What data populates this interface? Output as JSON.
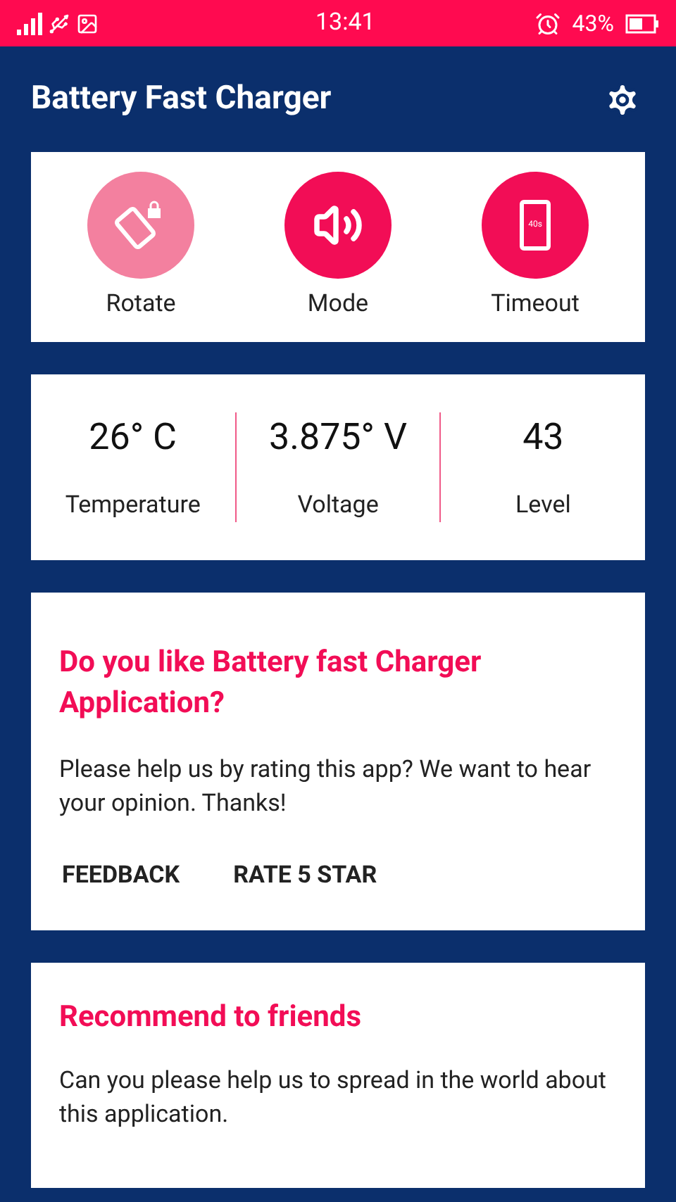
{
  "status_bar": {
    "time": "13:41",
    "battery": "43%"
  },
  "app_bar": {
    "title": "Battery Fast Charger"
  },
  "quick_actions": [
    {
      "kind": "rotate",
      "label": "Rotate",
      "on": false
    },
    {
      "kind": "mode",
      "label": "Mode",
      "on": true
    },
    {
      "kind": "timeout",
      "label": "Timeout",
      "on": true,
      "badge": "40s"
    }
  ],
  "stats": [
    {
      "value": "26° C",
      "label": "Temperature"
    },
    {
      "value": "3.875° V",
      "label": "Voltage"
    },
    {
      "value": "43",
      "label": "Level"
    }
  ],
  "rate_card": {
    "title": "Do you like Battery fast Charger Application?",
    "body": "Please help us by rating this app? We want to hear your opinion. Thanks!",
    "buttons": [
      "FEEDBACK",
      "RATE 5 STAR"
    ]
  },
  "recommend_card": {
    "title": "Recommend to friends",
    "body": "Can you please help us to spread in the world about this application."
  }
}
